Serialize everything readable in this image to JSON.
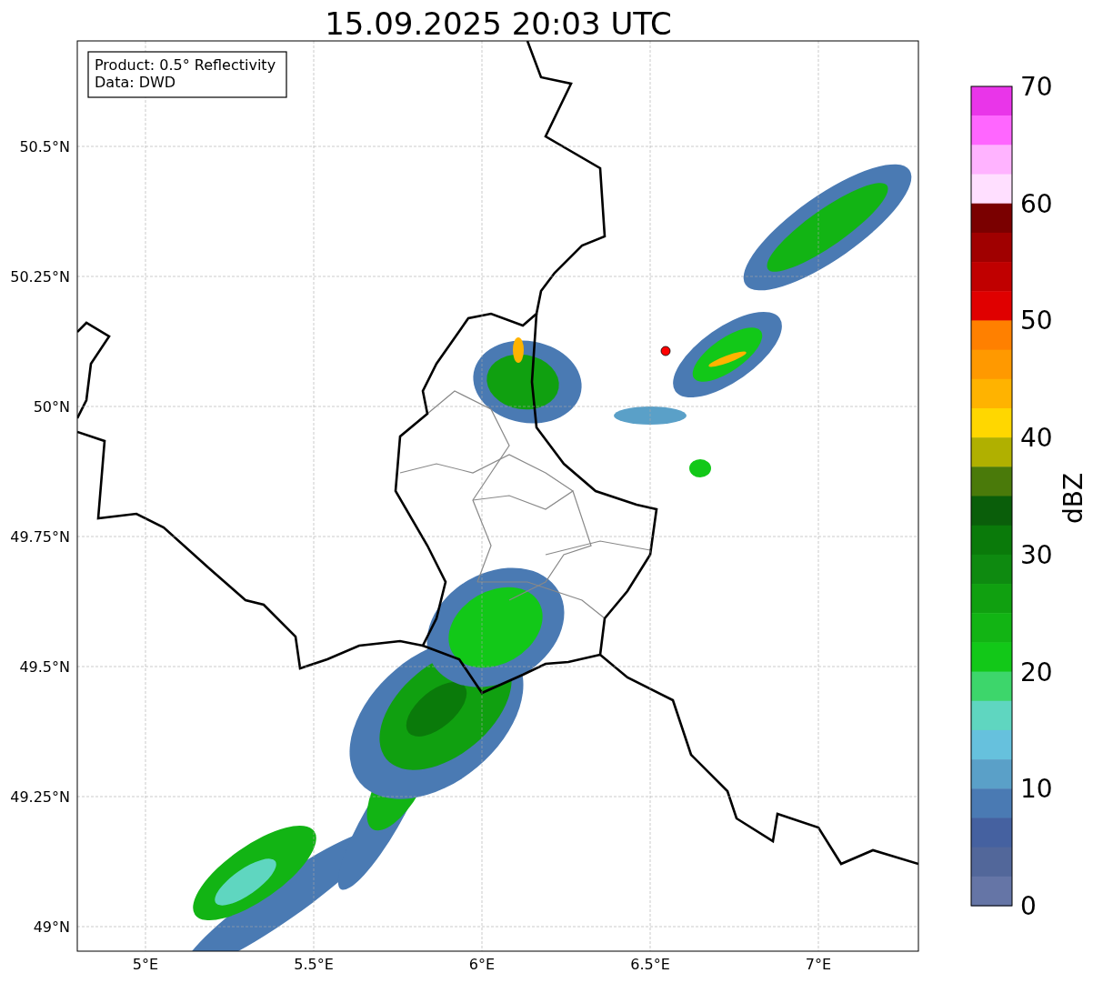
{
  "title": "15.09.2025 20:03 UTC",
  "info_box": [
    "Product: 0.5° Reflectivity",
    "Data: DWD"
  ],
  "map": {
    "x_ticks": [
      "5°E",
      "5.5°E",
      "6°E",
      "6.5°E",
      "7°E"
    ],
    "y_ticks": [
      "50.5°N",
      "50.25°N",
      "50°N",
      "49.75°N",
      "49.5°N",
      "49.25°N",
      "49°N"
    ]
  },
  "colorbar": {
    "label": "dBZ",
    "ticks": [
      "70",
      "60",
      "50",
      "40",
      "30",
      "20",
      "10",
      "0"
    ],
    "segments": [
      {
        "color": "#e935e9"
      },
      {
        "color": "#ff66ff"
      },
      {
        "color": "#ffb3ff"
      },
      {
        "color": "#ffdfff"
      },
      {
        "color": "#7a0000"
      },
      {
        "color": "#a00000"
      },
      {
        "color": "#c00000"
      },
      {
        "color": "#e00000"
      },
      {
        "color": "#ff8000"
      },
      {
        "color": "#ff9900"
      },
      {
        "color": "#ffb300"
      },
      {
        "color": "#ffd700"
      },
      {
        "color": "#b0b000"
      },
      {
        "color": "#4a7a0a"
      },
      {
        "color": "#0a5e0a"
      },
      {
        "color": "#0a7a0a"
      },
      {
        "color": "#0e8a10"
      },
      {
        "color": "#10a010"
      },
      {
        "color": "#12b414"
      },
      {
        "color": "#12c818"
      },
      {
        "color": "#3dd66b"
      },
      {
        "color": "#5fd6c0"
      },
      {
        "color": "#66c1dd"
      },
      {
        "color": "#5aa0c8"
      },
      {
        "color": "#4a7ab3"
      },
      {
        "color": "#4561a0"
      },
      {
        "color": "#52679a"
      },
      {
        "color": "#6575a6"
      }
    ]
  }
}
